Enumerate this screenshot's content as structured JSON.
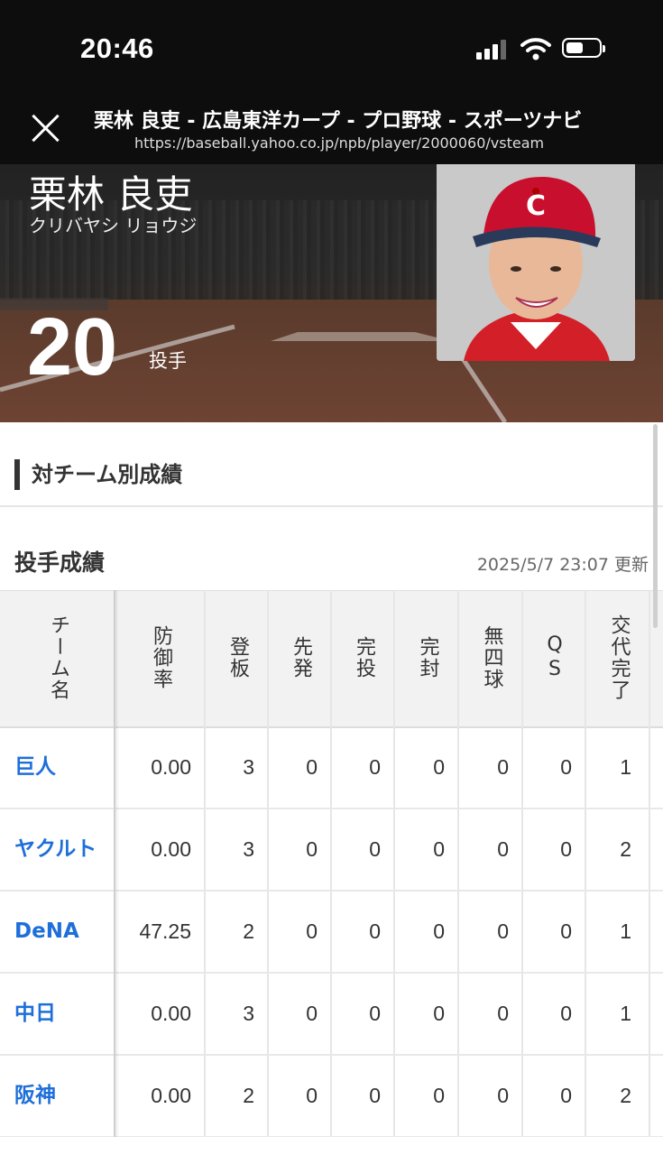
{
  "status": {
    "time": "20:46"
  },
  "browser": {
    "title": "栗林 良吏 - 広島東洋カープ - プロ野球 - スポーツナビ",
    "url": "https://baseball.yahoo.co.jp/npb/player/2000060/vsteam"
  },
  "player": {
    "name": "栗林 良吏",
    "kana": "クリバヤシ リョウジ",
    "number": "20",
    "position": "投手"
  },
  "section_title": "対チーム別成績",
  "subsection": {
    "title": "投手成績",
    "updated": "2025/5/7 23:07 更新"
  },
  "table": {
    "headers": [
      "チーム名",
      "防御率",
      "登板",
      "先発",
      "完投",
      "完封",
      "無四球",
      "QS",
      "交代完了"
    ],
    "rows": [
      {
        "team": "巨人",
        "era": "0.00",
        "g": "3",
        "gs": "0",
        "cg": "0",
        "sho": "0",
        "nobb": "0",
        "qs": "0",
        "gf": "1"
      },
      {
        "team": "ヤクルト",
        "era": "0.00",
        "g": "3",
        "gs": "0",
        "cg": "0",
        "sho": "0",
        "nobb": "0",
        "qs": "0",
        "gf": "2"
      },
      {
        "team": "DeNA",
        "era": "47.25",
        "g": "2",
        "gs": "0",
        "cg": "0",
        "sho": "0",
        "nobb": "0",
        "qs": "0",
        "gf": "1"
      },
      {
        "team": "中日",
        "era": "0.00",
        "g": "3",
        "gs": "0",
        "cg": "0",
        "sho": "0",
        "nobb": "0",
        "qs": "0",
        "gf": "1"
      },
      {
        "team": "阪神",
        "era": "0.00",
        "g": "2",
        "gs": "0",
        "cg": "0",
        "sho": "0",
        "nobb": "0",
        "qs": "0",
        "gf": "2"
      }
    ]
  },
  "colors": {
    "link": "#1e6fd9",
    "header_bg": "#0d0d0d"
  }
}
